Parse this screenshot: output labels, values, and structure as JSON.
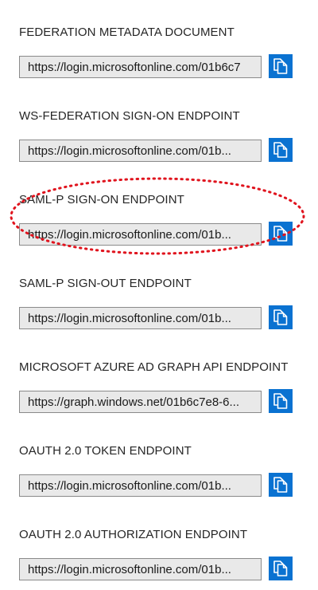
{
  "endpoints": [
    {
      "label": "FEDERATION METADATA DOCUMENT",
      "url": "https://login.microsoftonline.com/01b6c7"
    },
    {
      "label": "WS-FEDERATION SIGN-ON ENDPOINT",
      "url": "https://login.microsoftonline.com/01b..."
    },
    {
      "label": "SAML-P SIGN-ON ENDPOINT",
      "url": "https://login.microsoftonline.com/01b..."
    },
    {
      "label": "SAML-P SIGN-OUT ENDPOINT",
      "url": "https://login.microsoftonline.com/01b..."
    },
    {
      "label": "MICROSOFT AZURE AD GRAPH API ENDPOINT",
      "url": "https://graph.windows.net/01b6c7e8-6..."
    },
    {
      "label": "OAUTH 2.0 TOKEN ENDPOINT",
      "url": "https://login.microsoftonline.com/01b..."
    },
    {
      "label": "OAUTH 2.0 AUTHORIZATION ENDPOINT",
      "url": "https://login.microsoftonline.com/01b..."
    }
  ],
  "copy_icon": "copy-icon",
  "colors": {
    "copy_button": "#0a72d1",
    "field_background": "#e9e9e9",
    "highlight": "#e0141e"
  }
}
